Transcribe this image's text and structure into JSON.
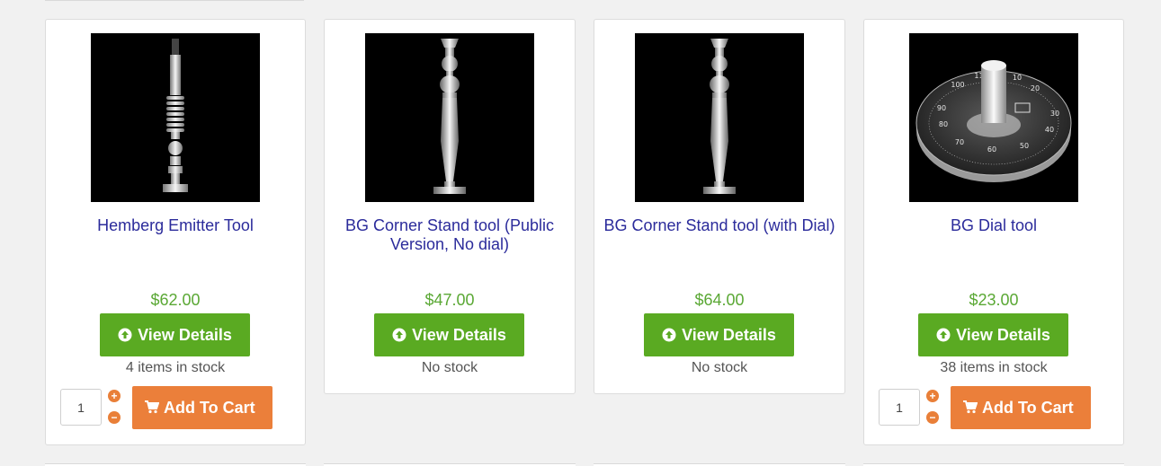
{
  "products": [
    {
      "title": "Hemberg Emitter Tool",
      "price": "$62.00",
      "view_label": "View Details",
      "stock": "4 items in stock",
      "qty": "1",
      "cart_label": "Add To Cart"
    },
    {
      "title": "BG Corner Stand tool (Public Version, No dial)",
      "price": "$47.00",
      "view_label": "View Details",
      "stock": "No stock"
    },
    {
      "title": "BG Corner Stand tool (with Dial)",
      "price": "$64.00",
      "view_label": "View Details",
      "stock": "No stock"
    },
    {
      "title": "BG Dial tool",
      "price": "$23.00",
      "view_label": "View Details",
      "stock": "38 items in stock",
      "qty": "1",
      "cart_label": "Add To Cart",
      "dial_numbers": [
        "100",
        "110",
        "10",
        "20",
        "30",
        "40",
        "50",
        "60",
        "70",
        "80",
        "90"
      ]
    }
  ],
  "icons": {
    "view": "arrow-circle-up-icon",
    "cart": "cart-icon",
    "plus": "plus-circle-icon",
    "minus": "minus-circle-icon"
  },
  "colors": {
    "title": "#2b2b9b",
    "price": "#5aa834",
    "view_button": "#5aaa22",
    "cart_button": "#eb7f3a"
  }
}
